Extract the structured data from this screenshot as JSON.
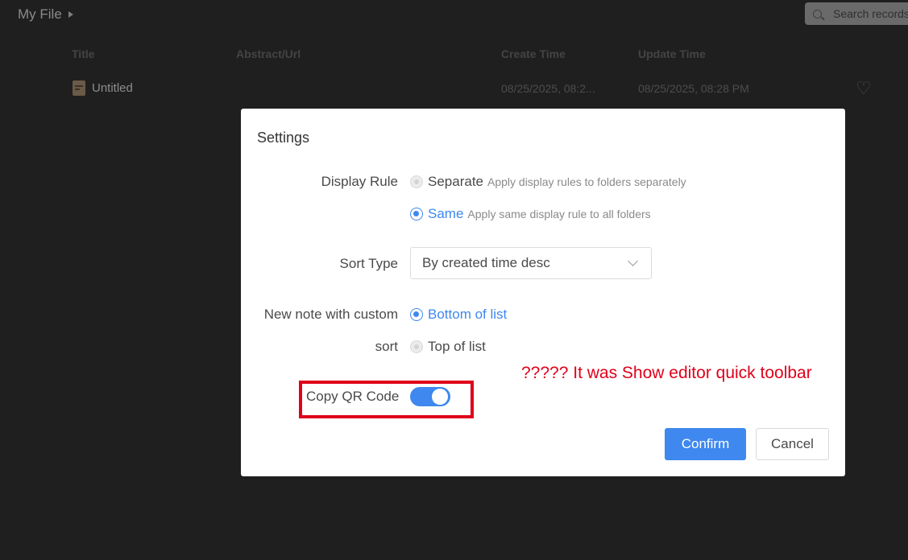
{
  "header": {
    "breadcrumb": "My File",
    "search_placeholder": "Search records"
  },
  "table": {
    "columns": [
      "Title",
      "Abstract/Url",
      "Create Time",
      "Update Time"
    ],
    "rows": [
      {
        "title": "Untitled",
        "abstract": "",
        "create_time": "08/25/2025, 08:2...",
        "update_time": "08/25/2025, 08:28 PM",
        "favorite_icon": "heart-icon"
      }
    ]
  },
  "settings": {
    "title": "Settings",
    "display_rule": {
      "label": "Display Rule",
      "options": [
        {
          "label": "Separate",
          "description": "Apply display rules to folders separately",
          "selected": false
        },
        {
          "label": "Same",
          "description": "Apply same display rule to all folders",
          "selected": true
        }
      ]
    },
    "sort_type": {
      "label": "Sort Type",
      "value": "By created time desc"
    },
    "new_note_sort": {
      "label_line1": "New note with custom",
      "label_line2": "sort",
      "options": [
        {
          "label": "Bottom of list",
          "selected": true
        },
        {
          "label": "Top of list",
          "selected": false
        }
      ]
    },
    "copy_qr": {
      "label": "Copy QR Code",
      "enabled": true
    },
    "confirm_label": "Confirm",
    "cancel_label": "Cancel"
  },
  "annotation": {
    "text": "????? It was Show editor quick toolbar",
    "color": "#e0001a"
  },
  "colors": {
    "accent": "#3e88ef",
    "background": "#1f1f1f",
    "modal": "#ffffff"
  }
}
